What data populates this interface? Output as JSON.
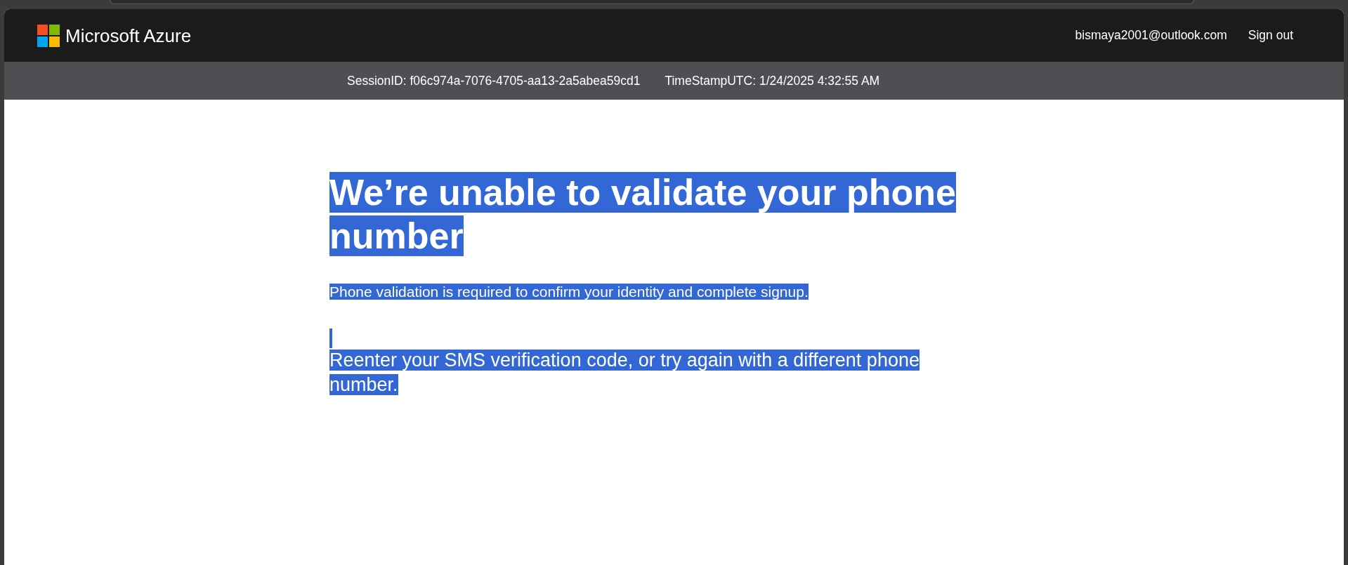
{
  "header": {
    "logo_text": "Microsoft Azure",
    "account_email": "bismaya2001@outlook.com",
    "sign_out": "Sign out"
  },
  "session_bar": {
    "session_id": "SessionID: f06c974a-7076-4705-aa13-2a5abea59cd1",
    "timestamp": "TimeStampUTC: 1/24/2025 4:32:55 AM"
  },
  "content": [
    {
      "kind": "heading",
      "text": "We’re unable to validate your phone number",
      "highlighted": true
    },
    {
      "kind": "paragraph",
      "text": "Phone validation is required to confirm your identity and complete signup.",
      "highlighted": true
    },
    {
      "kind": "blank",
      "highlighted": true
    },
    {
      "kind": "lead",
      "text": "Reenter your SMS verification code, or try again with a different phone number.",
      "highlighted": true
    }
  ]
}
